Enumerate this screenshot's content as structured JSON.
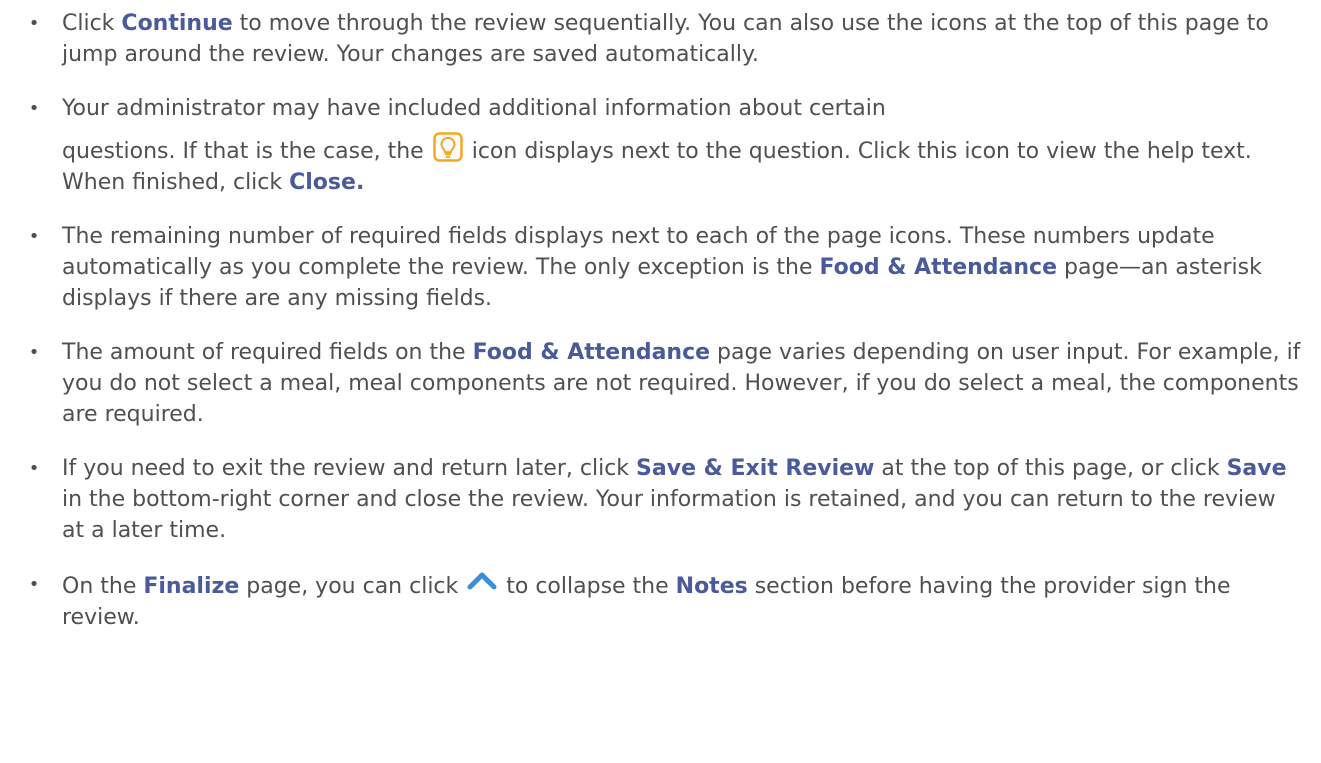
{
  "items": [
    {
      "parts": [
        {
          "t": "Click "
        },
        {
          "b": "Continue"
        },
        {
          "t": " to move through the review sequentially. You can also use the icons at the top of this page to jump around the review. Your changes are saved automatically."
        }
      ]
    },
    {
      "line1": "Your administrator may have included additional information about certain",
      "parts": [
        {
          "t": "questions. If that is the case, the "
        },
        {
          "icon": "lightbulb-help-icon"
        },
        {
          "t": " icon displays next to the question. Click this icon to view the help text. When finished, click "
        },
        {
          "b": "Close."
        }
      ]
    },
    {
      "parts": [
        {
          "t": "The remaining number of required fields displays next to each of the page icons. These numbers update automatically as you complete the review. The only exception is the "
        },
        {
          "b": "Food & Attendance"
        },
        {
          "t": " page—an asterisk displays if there are any missing fields."
        }
      ]
    },
    {
      "parts": [
        {
          "t": "The amount of required fields on the "
        },
        {
          "b": "Food & Attendance"
        },
        {
          "t": " page varies depending on user input. For example, if you do not select a meal, meal components are not required. However, if you do select a meal, the components are required."
        }
      ]
    },
    {
      "parts": [
        {
          "t": "If you need to exit the review and return later, click "
        },
        {
          "b": "Save & Exit Review"
        },
        {
          "t": " at the top of this page, or click "
        },
        {
          "b": "Save"
        },
        {
          "t": " in the bottom-right corner and close the review. Your information is retained, and you can return to the review at a later time."
        }
      ]
    },
    {
      "parts": [
        {
          "t": "On the "
        },
        {
          "b": "Finalize"
        },
        {
          "t": " page, you can click "
        },
        {
          "icon": "chevron-up-icon"
        },
        {
          "t": " to collapse the "
        },
        {
          "b": "Notes"
        },
        {
          "t": " section before having the provider sign the review."
        }
      ]
    }
  ],
  "bullet_char": "•",
  "colors": {
    "text": "#505050",
    "bold": "#4a5a9a",
    "icon_orange": "#f5a623",
    "icon_blue": "#3a8fd8"
  }
}
